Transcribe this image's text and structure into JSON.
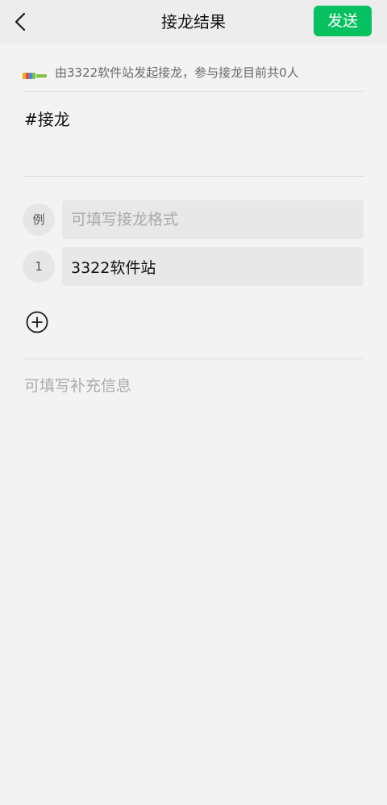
{
  "header": {
    "title": "接龙结果",
    "send_label": "发送"
  },
  "info": {
    "text": "由3322软件站发起接龙，参与接龙目前共0人",
    "logo_icon": "site-logo"
  },
  "topic": "#接龙",
  "entries": [
    {
      "badge": "例",
      "value": "",
      "placeholder": "可填写接龙格式"
    },
    {
      "badge": "1",
      "value": "3322软件站",
      "placeholder": ""
    }
  ],
  "supplement_placeholder": "可填写补充信息",
  "colors": {
    "accent": "#07c160",
    "background": "#f3f3f3",
    "header": "#ededed",
    "field": "#e8e8e8"
  }
}
